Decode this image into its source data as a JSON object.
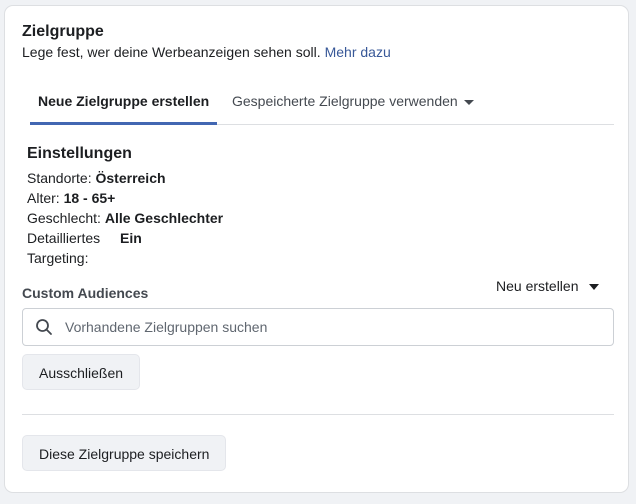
{
  "header": {
    "title": "Zielgruppe",
    "subtitle": "Lege fest, wer deine Werbeanzeigen sehen soll.",
    "more_link": "Mehr dazu"
  },
  "tabs": [
    {
      "label": "Neue Zielgruppe erstellen",
      "active": true
    },
    {
      "label": "Gespeicherte Zielgruppe verwenden",
      "active": false
    }
  ],
  "settings": {
    "heading": "Einstellungen",
    "locations_label": "Standorte:",
    "locations_value": "Österreich",
    "age_label": "Alter:",
    "age_value": "18 - 65+",
    "gender_label": "Geschlecht:",
    "gender_value": "Alle Geschlechter",
    "targeting_label_line1": "Detailliertes",
    "targeting_label_line2": "Targeting:",
    "targeting_value": "Ein"
  },
  "custom_audiences": {
    "label": "Custom Audiences",
    "new_create": "Neu erstellen",
    "search_placeholder": "Vorhandene Zielgruppen suchen",
    "exclude_button": "Ausschließen"
  },
  "footer": {
    "save_button": "Diese Zielgruppe speichern"
  },
  "colors": {
    "accent": "#4267b2",
    "link": "#385898"
  }
}
